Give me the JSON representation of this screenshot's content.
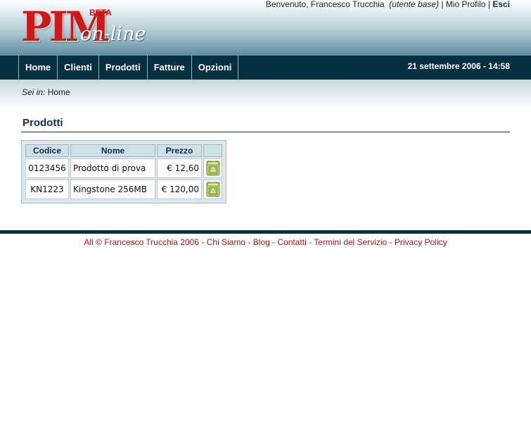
{
  "logo": {
    "pim": "PIM",
    "online": "on-line",
    "beta": "BETA"
  },
  "user": {
    "welcome": "Benvenuto, Francesco Trucchia",
    "role": "(utente base)",
    "sep1": "|",
    "profile": "Mio Profilo",
    "sep2": "|",
    "logout": "Esci"
  },
  "nav": {
    "items": [
      {
        "label": "Home"
      },
      {
        "label": "Clienti"
      },
      {
        "label": "Prodotti"
      },
      {
        "label": "Fatture"
      },
      {
        "label": "Opzioni"
      }
    ],
    "datetime": "21 settembre 2006 - 14:58"
  },
  "breadcrumb": {
    "prefix": "Sei in:",
    "current": "Home"
  },
  "section": {
    "title": "Prodotti"
  },
  "table": {
    "headers": [
      "Codice",
      "Nome",
      "Prezzo",
      ""
    ],
    "rows": [
      {
        "code": "0123456",
        "name": "Prodotto di prova",
        "price": "€ 12,60",
        "action_icon": "trash-bin-icon"
      },
      {
        "code": "KN1223",
        "name": "Kingstone 256MB",
        "price": "€ 120,00",
        "action_icon": "trash-bin-icon"
      }
    ]
  },
  "footer": {
    "copyright": "All © Francesco Trucchia 2006",
    "links": [
      "Chi Siamo",
      "Blog",
      "Contatti",
      "Termini del Servizio",
      "Privacy Policy"
    ],
    "separator": " - "
  },
  "colors": {
    "navbar": "#062f3f",
    "accent_red": "#cc1a1a",
    "footer_text": "#b01818",
    "table_header": "#cfe0e7"
  }
}
